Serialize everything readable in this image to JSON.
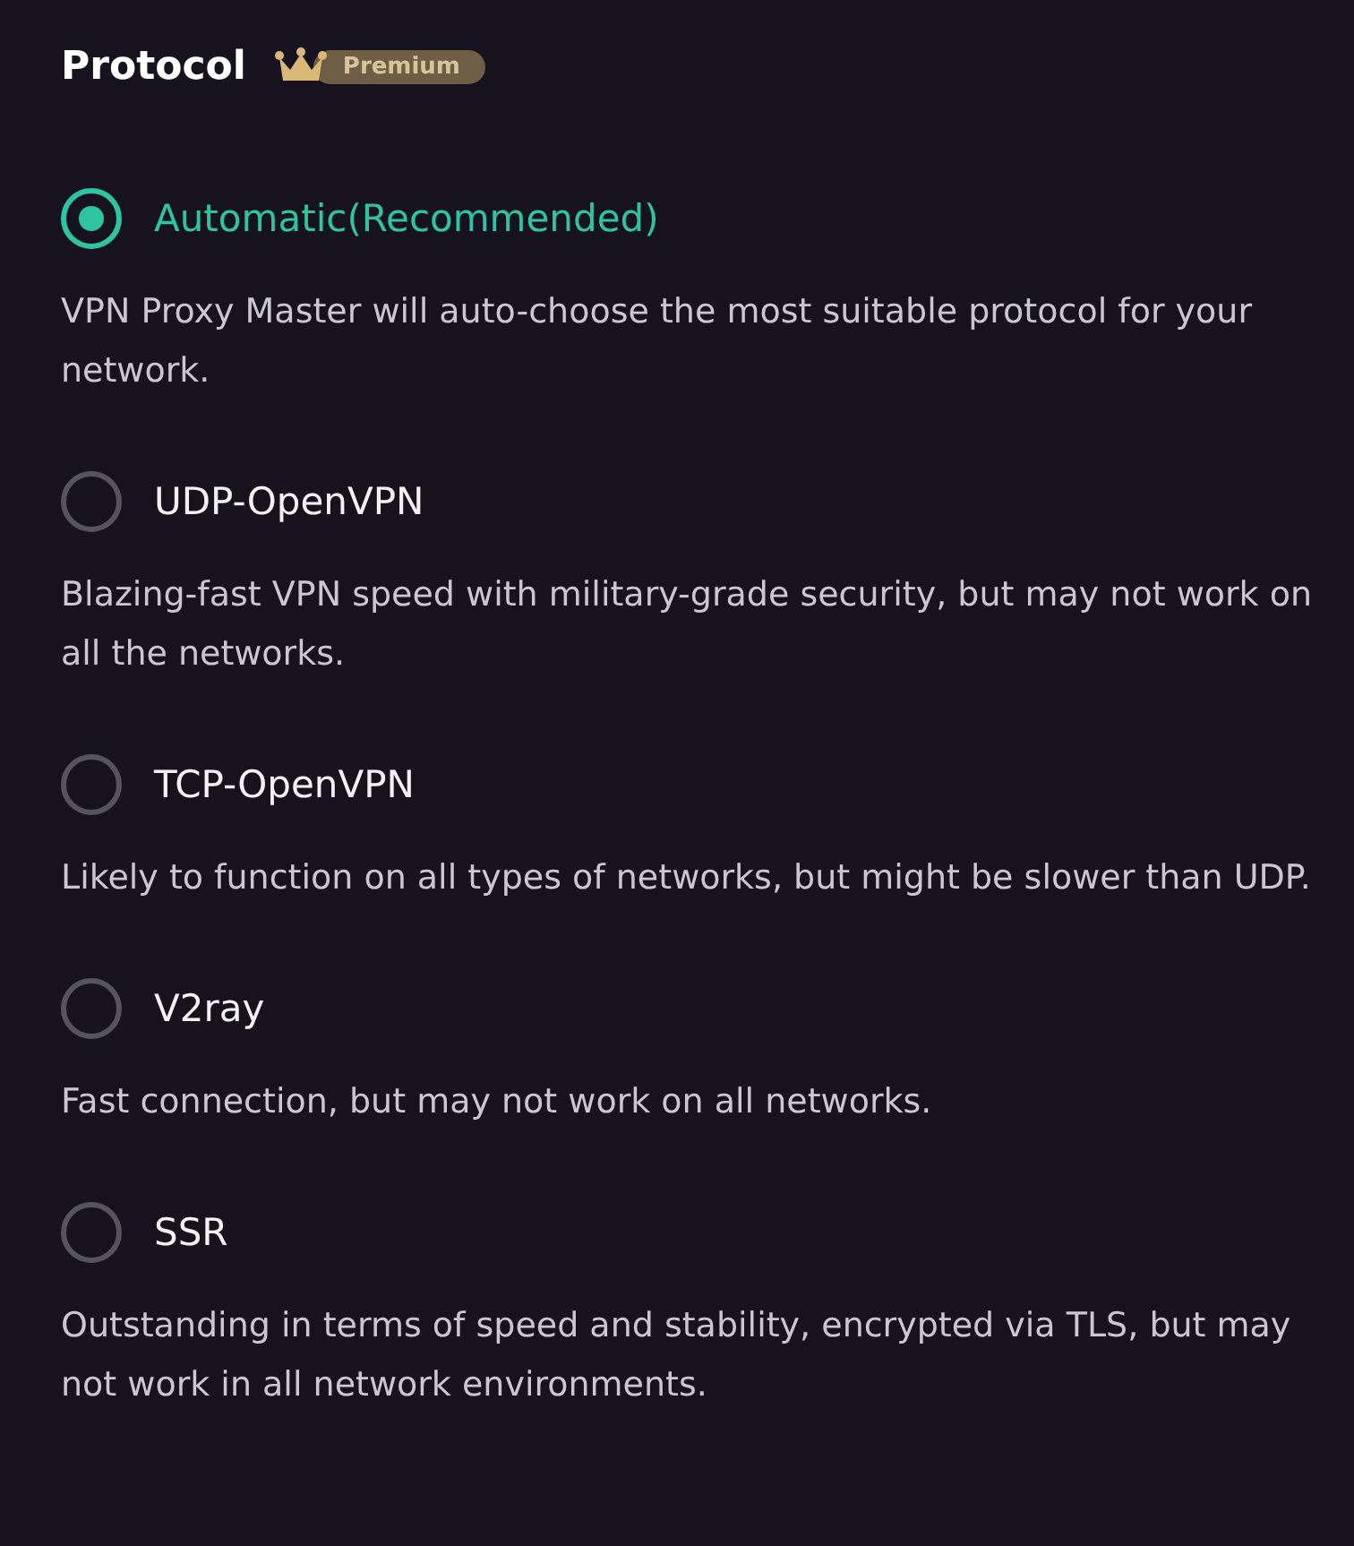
{
  "title": "Protocol",
  "badge": "Premium",
  "options": [
    {
      "label": "Automatic(Recommended)",
      "selected": true,
      "description": "VPN Proxy Master will auto-choose the most suitable protocol for your network."
    },
    {
      "label": "UDP-OpenVPN",
      "selected": false,
      "description": "Blazing-fast VPN speed with military-grade security, but may not work on all the networks."
    },
    {
      "label": "TCP-OpenVPN",
      "selected": false,
      "description": "Likely to function on all types of networks, but might be slower than UDP."
    },
    {
      "label": "V2ray",
      "selected": false,
      "description": "Fast connection, but may not work on all networks."
    },
    {
      "label": "SSR",
      "selected": false,
      "description": "Outstanding in terms of speed and stability, encrypted via TLS, but may not work in all network environments."
    }
  ]
}
